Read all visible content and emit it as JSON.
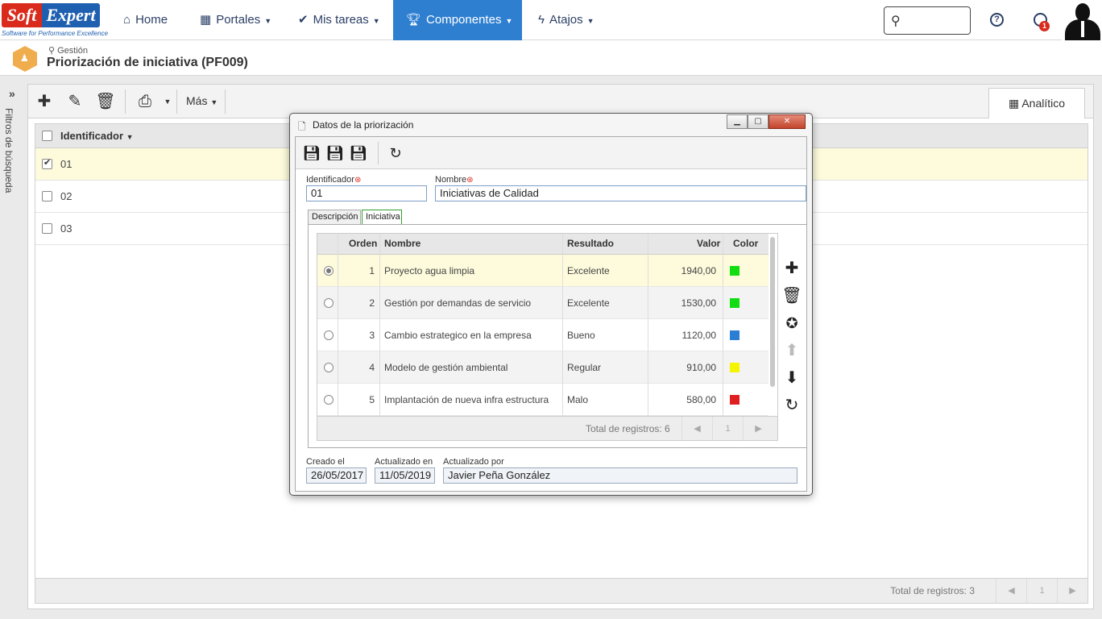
{
  "brand": {
    "soft": "Soft",
    "expert": "Expert",
    "tagline": "Software for Performance Excellence"
  },
  "nav": {
    "home": "Home",
    "portales": "Portales",
    "mis_tareas": "Mis tareas",
    "componentes": "Componentes",
    "atajos": "Atajos",
    "notification_count": "1",
    "help_glyph": "?"
  },
  "page": {
    "breadcrumb": "Gestión",
    "title": "Priorización de iniciativa (PF009)",
    "side_filter": "Filtros de búsqueda"
  },
  "toolbar": {
    "more": "Más",
    "analytic_tab": "Analítico"
  },
  "grid": {
    "column": "Identificador",
    "rows": [
      {
        "id": "01",
        "checked": true
      },
      {
        "id": "02",
        "checked": false
      },
      {
        "id": "03",
        "checked": false
      }
    ],
    "total": "Total de registros: 3",
    "page": "1"
  },
  "dialog": {
    "title": "Datos de la priorización",
    "fields": {
      "id_label": "Identificador",
      "id_value": "01",
      "name_label": "Nombre",
      "name_value": "Iniciativas de Calidad"
    },
    "tabs": [
      "Descripción",
      "Iniciativa"
    ],
    "active_tab": "Iniciativa",
    "table": {
      "headers": {
        "orden": "Orden",
        "nombre": "Nombre",
        "resultado": "Resultado",
        "valor": "Valor",
        "color": "Color"
      },
      "rows": [
        {
          "orden": "1",
          "nombre": "Proyecto agua limpia",
          "resultado": "Excelente",
          "valor": "1940,00",
          "color": "#11dd11"
        },
        {
          "orden": "2",
          "nombre": "Gestión por demandas de servicio",
          "resultado": "Excelente",
          "valor": "1530,00",
          "color": "#11dd11"
        },
        {
          "orden": "3",
          "nombre": "Cambio estrategico en la empresa",
          "resultado": "Bueno",
          "valor": "1120,00",
          "color": "#2a7fd4"
        },
        {
          "orden": "4",
          "nombre": "Modelo de gestión ambiental",
          "resultado": "Regular",
          "valor": "910,00",
          "color": "#f5f500"
        },
        {
          "orden": "5",
          "nombre": "Implantación de nueva infra estructura",
          "resultado": "Malo",
          "valor": "580,00",
          "color": "#e02020"
        }
      ],
      "total": "Total de registros: 6",
      "page": "1"
    },
    "audit": {
      "created_label": "Creado el",
      "created_value": "26/05/2017",
      "updated_label": "Actualizado en",
      "updated_value": "11/05/2019",
      "updated_by_label": "Actualizado por",
      "updated_by_value": "Javier Peña González"
    }
  },
  "colors": {
    "accent": "#2f7fd1",
    "brand_red": "#d92a1c",
    "brand_blue": "#1f5fb0",
    "selected_row": "#fdfbdc"
  }
}
